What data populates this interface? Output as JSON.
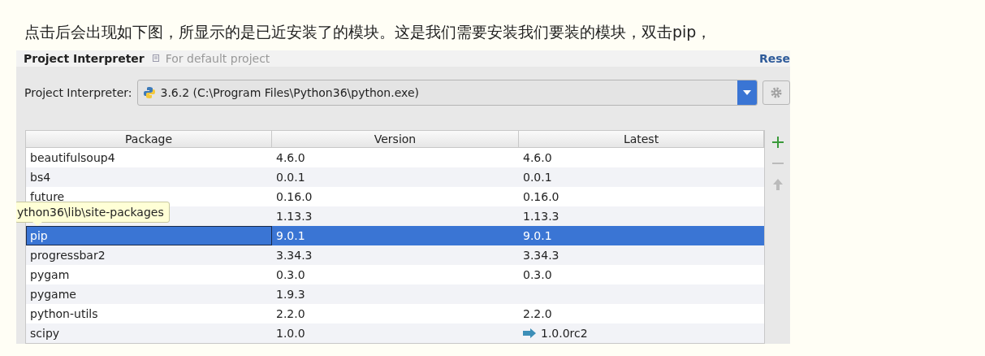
{
  "intro": "点击后会出现如下图，所显示的是已近安装了的模块。这是我们需要安装我们要装的模块，双击pip，",
  "panel": {
    "title": "Project Interpreter",
    "subtitle": "For default project",
    "reset_link": "Rese"
  },
  "interpreter": {
    "label": "Project Interpreter:",
    "value": "3.6.2 (C:\\Program Files\\Python36\\python.exe)"
  },
  "table": {
    "columns": [
      "Package",
      "Version",
      "Latest"
    ],
    "rows": [
      {
        "package": "beautifulsoup4",
        "version": "4.6.0",
        "latest": "4.6.0",
        "selected": false,
        "kind": "plain"
      },
      {
        "package": "bs4",
        "version": "0.0.1",
        "latest": "0.0.1",
        "selected": false,
        "kind": "plain"
      },
      {
        "package": "future",
        "version": "0.16.0",
        "latest": "0.16.0",
        "selected": false,
        "kind": "plain"
      },
      {
        "version": "1.13.3",
        "latest": "1.13.3",
        "selected": false,
        "kind": "plain"
      },
      {
        "package": "pip",
        "version": "9.0.1",
        "latest": "9.0.1",
        "selected": true,
        "kind": "plain"
      },
      {
        "package": "progressbar2",
        "version": "3.34.3",
        "latest": "3.34.3",
        "selected": false,
        "kind": "plain"
      },
      {
        "package": "pygam",
        "version": "0.3.0",
        "latest": "0.3.0",
        "selected": false,
        "kind": "plain"
      },
      {
        "package": "pygame",
        "version": "1.9.3",
        "selected": false,
        "kind": "plain"
      },
      {
        "package": "python-utils",
        "version": "2.2.0",
        "latest": "2.2.0",
        "selected": false,
        "kind": "plain"
      },
      {
        "package": "scipy",
        "version": "1.0.0",
        "latest": "1.0.0rc2",
        "selected": false,
        "kind": "upgrade"
      }
    ]
  },
  "tooltip": {
    "text": "ython36\\lib\\site-packages"
  }
}
